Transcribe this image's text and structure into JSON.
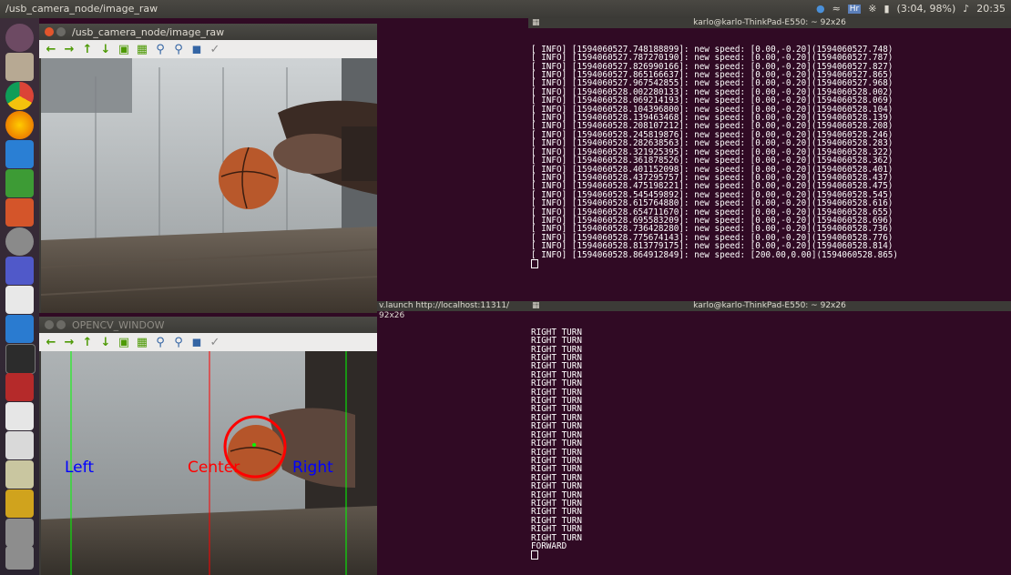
{
  "topbar": {
    "title": "/usb_camera_node/image_raw",
    "battery": "(3:04, 98%)",
    "clock": "20:35",
    "kbd": "Hr"
  },
  "launcher": {
    "icons": [
      "ubuntu-dash",
      "files",
      "chrome",
      "firefox",
      "libreoffice-writer",
      "libreoffice-calc",
      "libreoffice-impress",
      "settings",
      "teams",
      "app-e",
      "vscode",
      "terminal",
      "screenshot",
      "text-editor",
      "image-viewer",
      "camera",
      "screen-recorder",
      "help",
      "help-2"
    ]
  },
  "camera_window": {
    "title": "/usb_camera_node/image_raw"
  },
  "opencv_window": {
    "title": "OPENCV_WINDOW",
    "labels": {
      "left": "Left",
      "center": "Center",
      "right": "Right"
    }
  },
  "middle_terminal": {
    "title": "v.launch http://localhost:11311/ 92x26"
  },
  "terminal_top": {
    "title": "karlo@karlo-ThinkPad-E550: ~ 92x26",
    "lines": [
      "[ INFO] [1594060527.748188899]: new speed: [0.00,-0.20](1594060527.748)",
      "[ INFO] [1594060527.787270190]: new speed: [0.00,-0.20](1594060527.787)",
      "[ INFO] [1594060527.826990166]: new speed: [0.00,-0.20](1594060527.827)",
      "[ INFO] [1594060527.865166637]: new speed: [0.00,-0.20](1594060527.865)",
      "[ INFO] [1594060527.967542855]: new speed: [0.00,-0.20](1594060527.968)",
      "[ INFO] [1594060528.002280133]: new speed: [0.00,-0.20](1594060528.002)",
      "[ INFO] [1594060528.069214193]: new speed: [0.00,-0.20](1594060528.069)",
      "[ INFO] [1594060528.104396800]: new speed: [0.00,-0.20](1594060528.104)",
      "[ INFO] [1594060528.139463468]: new speed: [0.00,-0.20](1594060528.139)",
      "[ INFO] [1594060528.208107212]: new speed: [0.00,-0.20](1594060528.208)",
      "[ INFO] [1594060528.245819876]: new speed: [0.00,-0.20](1594060528.246)",
      "[ INFO] [1594060528.282638563]: new speed: [0.00,-0.20](1594060528.283)",
      "[ INFO] [1594060528.321925395]: new speed: [0.00,-0.20](1594060528.322)",
      "[ INFO] [1594060528.361878526]: new speed: [0.00,-0.20](1594060528.362)",
      "[ INFO] [1594060528.401152098]: new speed: [0.00,-0.20](1594060528.401)",
      "[ INFO] [1594060528.437295757]: new speed: [0.00,-0.20](1594060528.437)",
      "[ INFO] [1594060528.475198221]: new speed: [0.00,-0.20](1594060528.475)",
      "[ INFO] [1594060528.545459892]: new speed: [0.00,-0.20](1594060528.545)",
      "[ INFO] [1594060528.615764880]: new speed: [0.00,-0.20](1594060528.616)",
      "[ INFO] [1594060528.654711670]: new speed: [0.00,-0.20](1594060528.655)",
      "[ INFO] [1594060528.695583209]: new speed: [0.00,-0.20](1594060528.696)",
      "[ INFO] [1594060528.736428280]: new speed: [0.00,-0.20](1594060528.736)",
      "[ INFO] [1594060528.775674143]: new speed: [0.00,-0.20](1594060528.776)",
      "[ INFO] [1594060528.813779175]: new speed: [0.00,-0.20](1594060528.814)",
      "[ INFO] [1594060528.864912849]: new speed: [200.00,0.00](1594060528.865)"
    ]
  },
  "terminal_bottom": {
    "title": "karlo@karlo-ThinkPad-E550: ~ 92x26",
    "lines": [
      "RIGHT TURN",
      "RIGHT TURN",
      "RIGHT TURN",
      "RIGHT TURN",
      "RIGHT TURN",
      "RIGHT TURN",
      "RIGHT TURN",
      "RIGHT TURN",
      "RIGHT TURN",
      "RIGHT TURN",
      "RIGHT TURN",
      "RIGHT TURN",
      "RIGHT TURN",
      "RIGHT TURN",
      "RIGHT TURN",
      "RIGHT TURN",
      "RIGHT TURN",
      "RIGHT TURN",
      "RIGHT TURN",
      "RIGHT TURN",
      "RIGHT TURN",
      "RIGHT TURN",
      "RIGHT TURN",
      "RIGHT TURN",
      "RIGHT TURN",
      "FORWARD"
    ]
  },
  "colors": {
    "terminal_bg": "#300a24",
    "line_left": "#00ff00",
    "line_center": "#ff0000",
    "ball_circle": "#ff0000",
    "label_left": "#0000ff",
    "label_center": "#ff0000",
    "label_right": "#0000ff"
  }
}
